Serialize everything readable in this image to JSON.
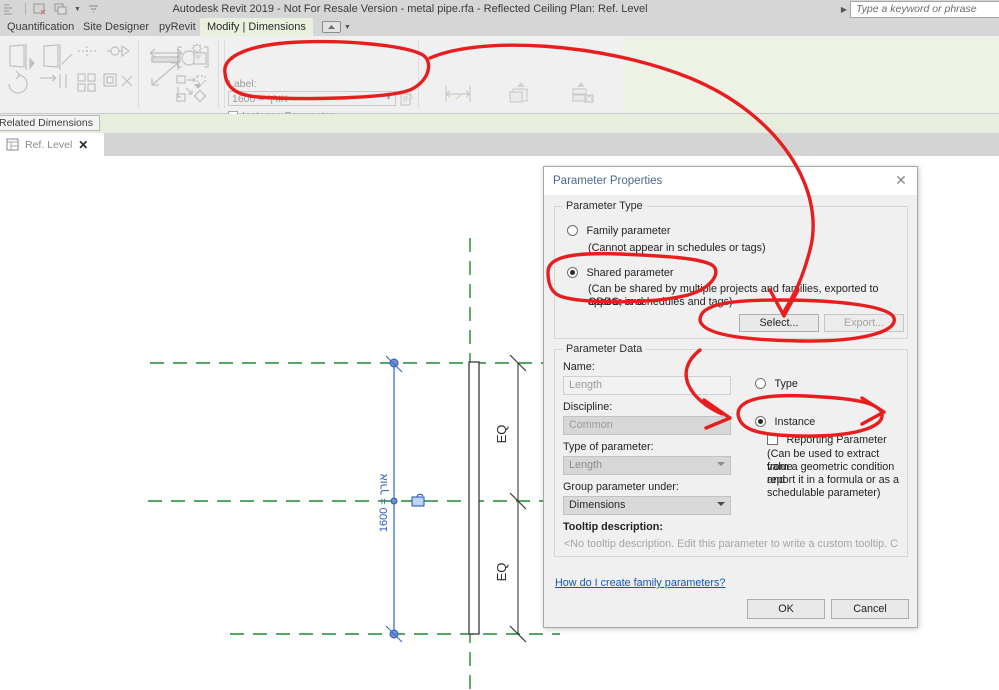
{
  "window": {
    "title": "Autodesk Revit 2019 - Not For Resale Version - metal pipe.rfa - Reflected Ceiling Plan: Ref. Level",
    "search_placeholder": "Type a keyword or phrase"
  },
  "ribbon": {
    "tabs": [
      {
        "label": "Quantification",
        "active": false
      },
      {
        "label": "Site Designer",
        "active": false
      },
      {
        "label": "pyRevit",
        "active": false
      },
      {
        "label": "Modify | Dimensions",
        "active": true
      }
    ],
    "label_group": {
      "caption": "Label:",
      "combo_value": "1600 = אורך",
      "instance_parameter_label": "Instance Parameter",
      "instance_parameter_checked": true
    },
    "buttons": [
      {
        "label": "Edit\nWitness Lines",
        "name": "edit-witness-lines"
      },
      {
        "label": "Load into\nProject",
        "name": "load-into-project"
      },
      {
        "label": "Load into\nProject and Close",
        "name": "load-into-project-and-close"
      }
    ]
  },
  "options_bar": {
    "button_label": "Related Dimensions"
  },
  "view_tab": {
    "name": "Ref. Level",
    "close": "✕"
  },
  "canvas": {
    "dimension_text": "1600 = אורך",
    "eq_top": "EQ",
    "eq_bottom": "EQ"
  },
  "dialog": {
    "title": "Parameter Properties",
    "close": "✕",
    "parameter_type": {
      "group_title": "Parameter Type",
      "family_parameter": "Family parameter",
      "family_note": "(Cannot appear in schedules or tags)",
      "shared_parameter": "Shared parameter",
      "shared_note_1": "(Can be shared by multiple projects and families, exported to ODBC, and",
      "shared_note_2": "appear in schedules and tags)",
      "selected": "shared",
      "select_button": "Select...",
      "export_button": "Export..."
    },
    "parameter_data": {
      "group_title": "Parameter Data",
      "name_label": "Name:",
      "name_value": "Length",
      "discipline_label": "Discipline:",
      "discipline_value": "Common",
      "type_of_parameter_label": "Type of parameter:",
      "type_of_parameter_value": "Length",
      "group_parameter_label": "Group parameter under:",
      "group_parameter_value": "Dimensions",
      "tooltip_label": "Tooltip description:",
      "tooltip_value": "<No tooltip description. Edit this parameter to write a custom tooltip. Custom t...",
      "type_radio": "Type",
      "instance_radio": "Instance",
      "binding_selected": "instance",
      "reporting_parameter": "Reporting Parameter",
      "reporting_checked": false,
      "reporting_note_1": "(Can be used to extract value",
      "reporting_note_2": "from a geometric condition and",
      "reporting_note_3": "report it in a formula or as a",
      "reporting_note_4": "schedulable parameter)"
    },
    "help_link": "How do I create family parameters?",
    "ok_button": "OK",
    "cancel_button": "Cancel"
  },
  "colors": {
    "annotation_red": "#e81e1e",
    "dimension_blue": "#3c6fd8",
    "reference_green": "#1e8a2e",
    "ribbon_active": "#eaf0de",
    "chrome_gray": "#d6d6d6"
  }
}
